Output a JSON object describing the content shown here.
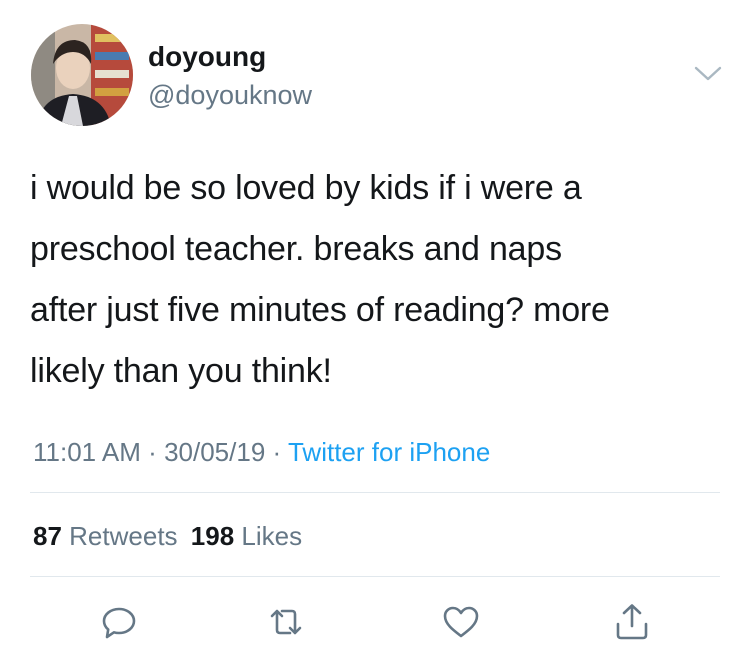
{
  "user": {
    "display_name": "doyoung",
    "handle": "@doyouknow",
    "avatar_icon": "avatar-photo"
  },
  "tweet": {
    "lines": [
      "i would be so loved by kids if i were a",
      "preschool teacher. breaks and naps",
      "after just five minutes of reading? more",
      "likely than you think!"
    ]
  },
  "meta": {
    "time": "11:01 AM",
    "sep1": "·",
    "date": "30/05/19",
    "sep2": "·",
    "source": "Twitter for iPhone"
  },
  "stats": {
    "retweets_count": "87",
    "retweets_label": "Retweets",
    "likes_count": "198",
    "likes_label": "Likes"
  },
  "actions": {
    "reply_icon": "reply-icon",
    "retweet_icon": "retweet-icon",
    "like_icon": "heart-icon",
    "share_icon": "share-icon"
  },
  "colors": {
    "text": "#14171a",
    "secondary": "#657786",
    "link": "#1da1f2",
    "icon": "#657786",
    "divider": "#e1e8ed"
  }
}
